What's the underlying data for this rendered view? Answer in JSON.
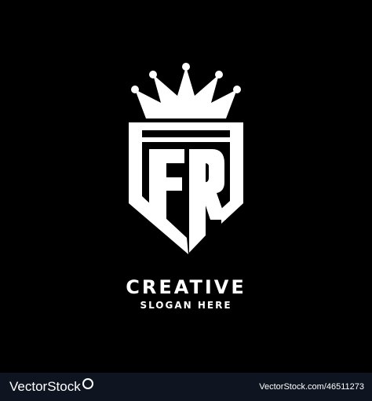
{
  "logo": {
    "monogram": "FR",
    "headline": "CREATIVE",
    "tagline": "SLOGAN HERE"
  },
  "footer": {
    "brand": "VectorStock",
    "source": "VectorStock.com/46511273"
  },
  "colors": {
    "background": "#000000",
    "foreground": "#ffffff",
    "footer_bar": "#0e1520"
  },
  "icons": {
    "crown": "crown-icon",
    "shield": "shield-icon",
    "brand_mark": "registered-circle-icon"
  }
}
